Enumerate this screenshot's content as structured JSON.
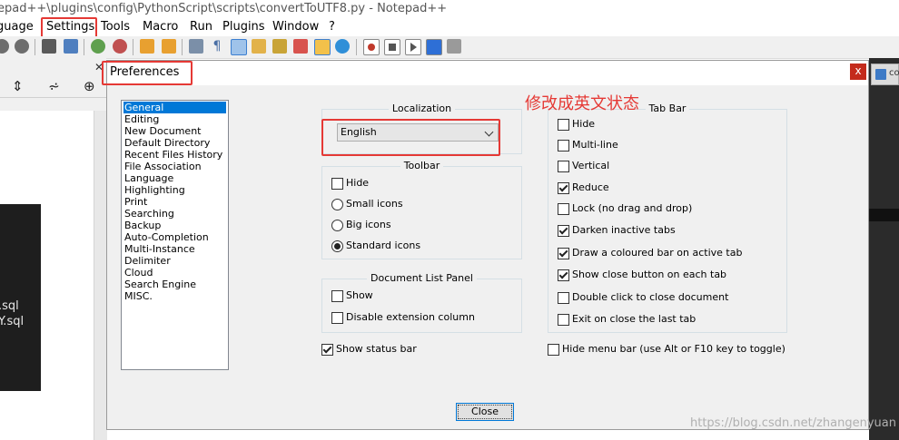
{
  "window": {
    "title": "epad++\\plugins\\config\\PythonScript\\scripts\\convertToUTF8.py - Notepad++"
  },
  "menubar": {
    "items": [
      "guage",
      "Settings",
      "Tools",
      "Macro",
      "Run",
      "Plugins",
      "Window",
      "?"
    ]
  },
  "left_panel": {
    "files": [
      ".sql",
      "Y.sql"
    ]
  },
  "dialog": {
    "title": "Preferences",
    "close_glyph": "x",
    "categories": [
      "General",
      "Editing",
      "New Document",
      "Default Directory",
      "Recent Files History",
      "File Association",
      "Language",
      "Highlighting",
      "Print",
      "Searching",
      "Backup",
      "Auto-Completion",
      "Multi-Instance",
      "Delimiter",
      "Cloud",
      "Search Engine",
      "MISC."
    ],
    "selected_category": "General",
    "localization": {
      "title": "Localization",
      "value": "English"
    },
    "toolbar": {
      "title": "Toolbar",
      "hide": "Hide",
      "small": "Small icons",
      "big": "Big icons",
      "standard": "Standard icons",
      "selected": "Standard icons"
    },
    "doclist": {
      "title": "Document List Panel",
      "show": "Show",
      "disable_ext": "Disable extension column"
    },
    "status_bar": "Show status bar",
    "tabbar": {
      "title": "Tab Bar",
      "items": [
        {
          "label": "Hide",
          "checked": false
        },
        {
          "label": "Multi-line",
          "checked": false
        },
        {
          "label": "Vertical",
          "checked": false
        },
        {
          "label": "Reduce",
          "checked": true
        },
        {
          "label": "Lock (no drag and drop)",
          "checked": false
        },
        {
          "label": "Darken inactive tabs",
          "checked": true
        },
        {
          "label": "Draw a coloured bar on active tab",
          "checked": true
        },
        {
          "label": "Show close button on each tab",
          "checked": true
        },
        {
          "label": "Double click to close document",
          "checked": false
        },
        {
          "label": "Exit on close the last tab",
          "checked": false
        }
      ]
    },
    "hide_menu": "Hide menu bar (use Alt or F10 key to toggle)",
    "close_button": "Close"
  },
  "annotation": {
    "text": "修改成英文状态",
    "color": "#e53935"
  },
  "watermark": "https://blog.csdn.net/zhangenyuan",
  "right_panel": {
    "tab_label": "co"
  }
}
